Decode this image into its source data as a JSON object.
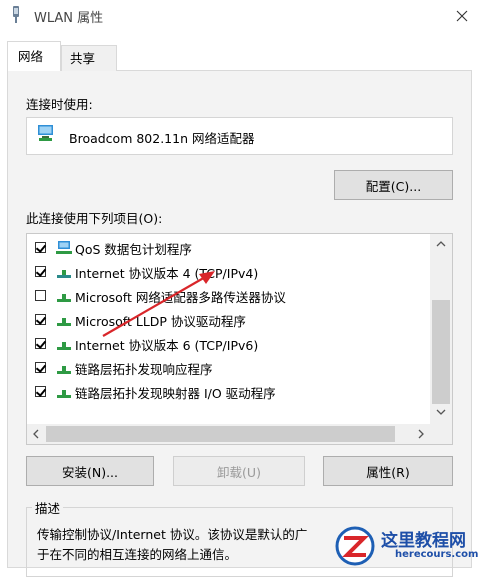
{
  "window": {
    "title": "WLAN 属性"
  },
  "tabs": [
    {
      "label": "网络",
      "active": true
    },
    {
      "label": "共享",
      "active": false
    }
  ],
  "connect_using": {
    "label": "连接时使用:",
    "adapter_name": "Broadcom 802.11n 网络适配器",
    "configure_label": "配置(C)..."
  },
  "items_section": {
    "label": "此连接使用下列项目(O):",
    "items": [
      {
        "label": "QoS 数据包计划程序",
        "checked": true,
        "icon": "qos-icon"
      },
      {
        "label": "Internet 协议版本 4 (TCP/IPv4)",
        "checked": true,
        "icon": "network-protocol-icon"
      },
      {
        "label": "Microsoft 网络适配器多路传送器协议",
        "checked": false,
        "icon": "network-protocol-icon"
      },
      {
        "label": "Microsoft LLDP 协议驱动程序",
        "checked": true,
        "icon": "network-protocol-icon"
      },
      {
        "label": "Internet 协议版本 6 (TCP/IPv6)",
        "checked": true,
        "icon": "network-protocol-icon"
      },
      {
        "label": "链路层拓扑发现响应程序",
        "checked": true,
        "icon": "network-protocol-icon"
      },
      {
        "label": "链路层拓扑发现映射器 I/O 驱动程序",
        "checked": true,
        "icon": "network-protocol-icon"
      }
    ]
  },
  "buttons": {
    "install": "安装(N)...",
    "uninstall": "卸载(U)",
    "properties": "属性(R)"
  },
  "description": {
    "title": "描述",
    "text_line1": "传输控制协议/Internet 协议。该协议是默认的广",
    "text_line2": "于在不同的相互连接的网络上通信。"
  },
  "watermark": {
    "title": "这里教程网",
    "url": "herecours.com"
  },
  "colors": {
    "annotation_arrow": "#d9262a",
    "scrollbar_thumb": "#cdcdcd",
    "panel_bg": "#f3f3f3"
  }
}
